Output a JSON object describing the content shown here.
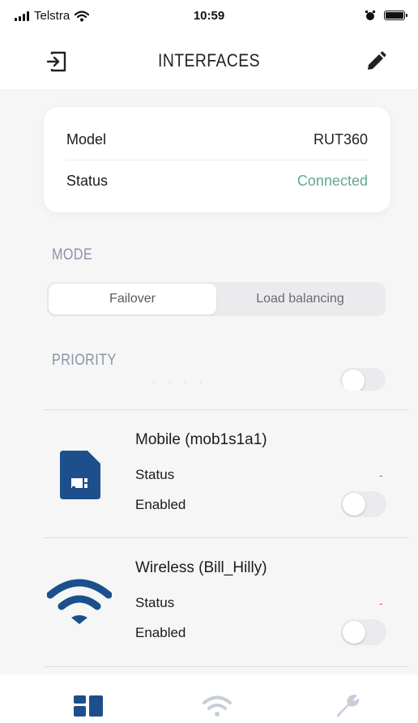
{
  "status_bar": {
    "carrier": "Telstra",
    "time": "10:59",
    "icons": [
      "signal-bars-icon",
      "wifi-icon",
      "alarm-icon",
      "battery-icon"
    ]
  },
  "header": {
    "title": "INTERFACES",
    "left_icon": "logout-icon",
    "right_icon": "edit-pencil-icon"
  },
  "device_info": {
    "rows": [
      {
        "label": "Model",
        "value": "RUT360"
      },
      {
        "label": "Status",
        "value": "Connected"
      }
    ]
  },
  "mode": {
    "label": "MODE",
    "options": [
      "Failover",
      "Load balancing"
    ],
    "selected": "Failover"
  },
  "priority": {
    "label": "PRIORITY",
    "interfaces": [
      {
        "name": "Mobile (mob1s1a1)",
        "icon": "sim-card-icon",
        "status_label": "Status",
        "status_value": "-",
        "enabled_label": "Enabled",
        "enabled": false
      },
      {
        "name": "Wireless (Bill_Hilly)",
        "icon": "wifi-icon",
        "status_label": "Status",
        "status_value": "-",
        "enabled_label": "Enabled",
        "enabled": false
      }
    ]
  },
  "tab_bar": {
    "tabs": [
      {
        "icon": "dashboard-icon",
        "active": true
      },
      {
        "icon": "wifi-icon",
        "active": false
      },
      {
        "icon": "wrench-icon",
        "active": false
      }
    ]
  },
  "colors": {
    "accent": "#1c4f8c",
    "status_connected": "#5fa98a",
    "status_dash_red": "#d9534f",
    "section_label": "#8a93a6"
  }
}
